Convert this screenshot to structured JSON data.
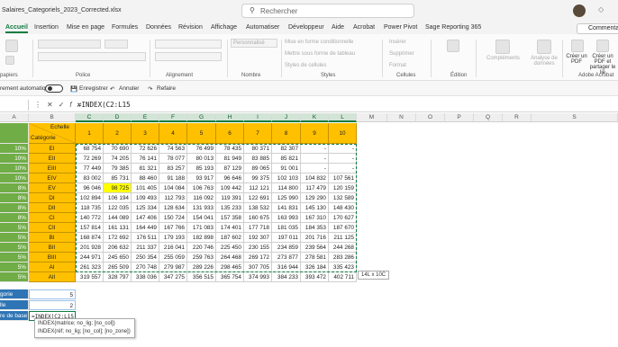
{
  "app": {
    "file_name": "Salaires_Categoriels_2023_Corrected.xlsx",
    "search_placeholder": "Rechercher",
    "comment_label": "Commentai"
  },
  "ribbon_tabs": [
    "Accueil",
    "Insertion",
    "Mise en page",
    "Formules",
    "Données",
    "Révision",
    "Affichage",
    "Automatiser",
    "Développeur",
    "Aide",
    "Acrobat",
    "Power Pivot",
    "Sage Reporting 365"
  ],
  "ribbon": {
    "groups": {
      "clipboard": "papiers",
      "font": "Police",
      "alignment": "Alignement",
      "number": "Nombre",
      "styles": "Styles",
      "cells": "Cellules",
      "editing": "Édition",
      "acrobat": "Adobe Acrobat"
    },
    "number_format": "Personnalisé",
    "styles_items": [
      "Mise en forme conditionnelle",
      "Mettre sous forme de tableau",
      "Styles de cellules"
    ],
    "cells_items": [
      "Insérer",
      "Supprimer",
      "Format"
    ],
    "big_buttons": [
      "Compléments",
      "Analyse de données",
      "Créer un PDF",
      "Créer un PDF et partager le lie"
    ]
  },
  "qat": {
    "autosave": "rement automatique",
    "save": "Enregistrer",
    "undo": "Annuler",
    "redo": "Refaire"
  },
  "formula_bar": {
    "formula": "=INDEX(C2:L15"
  },
  "columns": [
    "A",
    "B",
    "C",
    "D",
    "E",
    "F",
    "G",
    "H",
    "I",
    "J",
    "K",
    "L",
    "M",
    "N",
    "O",
    "P",
    "Q",
    "R",
    "S"
  ],
  "table": {
    "corner_top": "Echelle",
    "corner_bottom": "Catégorie",
    "headers": [
      "1",
      "2",
      "3",
      "4",
      "5",
      "6",
      "7",
      "8",
      "9",
      "10"
    ],
    "rows": [
      {
        "pct": "10%",
        "cat": "EI",
        "vals": [
          "68 754",
          "70 690",
          "72 626",
          "74 563",
          "76 499",
          "78 435",
          "80 371",
          "82 307",
          "-",
          "-"
        ]
      },
      {
        "pct": "10%",
        "cat": "EII",
        "vals": [
          "72 269",
          "74 205",
          "76 141",
          "78 077",
          "80 013",
          "81 949",
          "83 885",
          "85 821",
          "-",
          "-"
        ]
      },
      {
        "pct": "10%",
        "cat": "EIII",
        "vals": [
          "77 449",
          "79 385",
          "81 321",
          "83 257",
          "85 193",
          "87 129",
          "89 065",
          "91 001",
          "-",
          "-"
        ]
      },
      {
        "pct": "10%",
        "cat": "EIV",
        "vals": [
          "83 002",
          "85 731",
          "88 460",
          "91 188",
          "93 917",
          "96 646",
          "99 375",
          "102 103",
          "104 832",
          "107 561"
        ]
      },
      {
        "pct": "8%",
        "cat": "EV",
        "vals": [
          "96 046",
          "98 725",
          "101 405",
          "104 084",
          "106 763",
          "109 442",
          "112 121",
          "114 800",
          "117 479",
          "120 159"
        ]
      },
      {
        "pct": "8%",
        "cat": "DI",
        "vals": [
          "102 894",
          "106 194",
          "109 493",
          "112 793",
          "116 092",
          "119 391",
          "122 691",
          "125 990",
          "129 290",
          "132 589"
        ]
      },
      {
        "pct": "8%",
        "cat": "DII",
        "vals": [
          "118 735",
          "122 035",
          "125 334",
          "128 634",
          "131 933",
          "135 233",
          "138 532",
          "141 831",
          "145 130",
          "148 430"
        ]
      },
      {
        "pct": "8%",
        "cat": "CI",
        "vals": [
          "140 772",
          "144 089",
          "147 406",
          "150 724",
          "154 041",
          "157 358",
          "160 675",
          "163 993",
          "167 310",
          "170 627"
        ]
      },
      {
        "pct": "5%",
        "cat": "CII",
        "vals": [
          "157 814",
          "161 131",
          "164 449",
          "167 766",
          "171 083",
          "174 401",
          "177 718",
          "181 035",
          "184 353",
          "187 670"
        ]
      },
      {
        "pct": "5%",
        "cat": "BI",
        "vals": [
          "168 874",
          "172 692",
          "176 511",
          "179 193",
          "182 898",
          "187 602",
          "192 307",
          "197 011",
          "201 716",
          "211 125"
        ]
      },
      {
        "pct": "5%",
        "cat": "BII",
        "vals": [
          "201 928",
          "206 632",
          "211 337",
          "216 041",
          "220 746",
          "225 450",
          "230 155",
          "234 859",
          "239 564",
          "244 268"
        ]
      },
      {
        "pct": "5%",
        "cat": "BIII",
        "vals": [
          "244 971",
          "245 650",
          "250 354",
          "255 059",
          "259 763",
          "264 468",
          "269 172",
          "273 877",
          "278 581",
          "283 286"
        ]
      },
      {
        "pct": "5%",
        "cat": "AI",
        "vals": [
          "261 323",
          "265 509",
          "270 748",
          "279 987",
          "289 226",
          "298 465",
          "307 705",
          "316 944",
          "326 184",
          "335 423"
        ]
      },
      {
        "pct": "5%",
        "cat": "AII",
        "vals": [
          "319 557",
          "328 797",
          "338 036",
          "347 275",
          "356 515",
          "365 754",
          "374 993",
          "384 233",
          "393 472",
          "402 711"
        ]
      }
    ]
  },
  "lookup": {
    "row1_label": "gorie",
    "row1_value": "5",
    "row2_label": "lle",
    "row2_value": "2",
    "row3_label": "re de base",
    "row3_value": "=INDEX(C2:L15"
  },
  "tooltip": {
    "line1": "INDEX(matrice; no_lig; [no_col])",
    "line2": "INDEX(réf; no_lig; [no_col]; [no_zone])"
  },
  "size_tip": "14L x 10C",
  "colors": {
    "excel_green": "#107c41",
    "pct_green": "#70ad47",
    "header_yellow": "#ffc000",
    "highlight": "#ffff00",
    "label_blue": "#2f75b5"
  }
}
